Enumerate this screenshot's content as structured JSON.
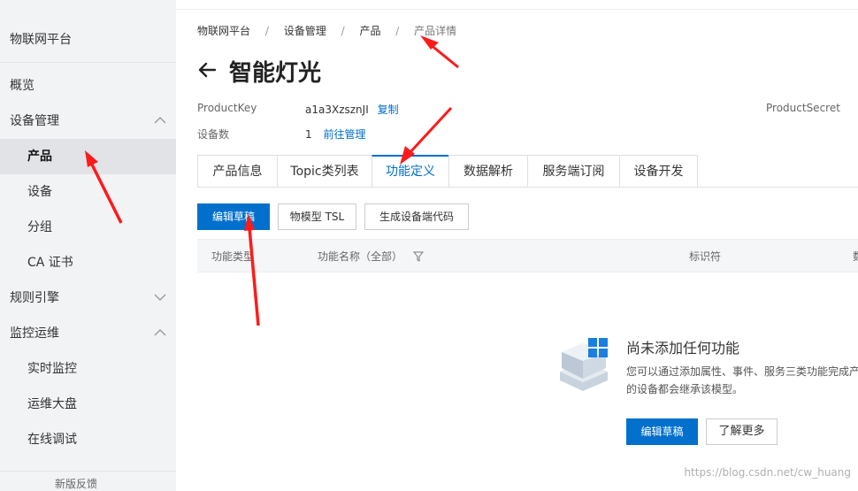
{
  "sidebar": {
    "title": "物联网平台",
    "items": [
      {
        "label": "概览"
      },
      {
        "label": "设备管理"
      },
      {
        "label": "产品"
      },
      {
        "label": "设备"
      },
      {
        "label": "分组"
      },
      {
        "label": "CA 证书"
      },
      {
        "label": "规则引擎"
      },
      {
        "label": "监控运维"
      },
      {
        "label": "实时监控"
      },
      {
        "label": "运维大盘"
      },
      {
        "label": "在线调试"
      }
    ],
    "feedback": "新版反馈"
  },
  "breadcrumb": [
    "物联网平台",
    "设备管理",
    "产品",
    "产品详情"
  ],
  "breadcrumb_sep": "/",
  "page_title": "智能灯光",
  "product": {
    "key_label": "ProductKey",
    "key_value": "a1a3XzsznJI",
    "copy_label": "复制",
    "secret_label": "ProductSecret",
    "device_count_label": "设备数",
    "device_count_value": "1",
    "manage_label": "前往管理"
  },
  "tabs": [
    {
      "label": "产品信息"
    },
    {
      "label": "Topic类列表"
    },
    {
      "label": "功能定义",
      "active": true
    },
    {
      "label": "数据解析"
    },
    {
      "label": "服务端订阅"
    },
    {
      "label": "设备开发"
    }
  ],
  "toolbar": {
    "edit_draft": "编辑草稿",
    "tsl": "物模型 TSL",
    "gen_code": "生成设备端代码"
  },
  "table": {
    "columns": [
      "功能类型",
      "功能名称（全部）",
      "标识符",
      "数"
    ]
  },
  "empty_state": {
    "title": "尚未添加任何功能",
    "desc_line1": "您可以通过添加属性、事件、服务三类功能完成产",
    "desc_line2": "的设备都会继承该模型。",
    "edit_button": "编辑草稿",
    "learn_more": "了解更多"
  },
  "watermark": "https://blog.csdn.net/cw_huang",
  "colors": {
    "accent": "#0070cc",
    "brand_orange": "#ff6a00",
    "annotation_red": "#ff1a1a",
    "sidebar_bg": "#f2f3f5"
  }
}
